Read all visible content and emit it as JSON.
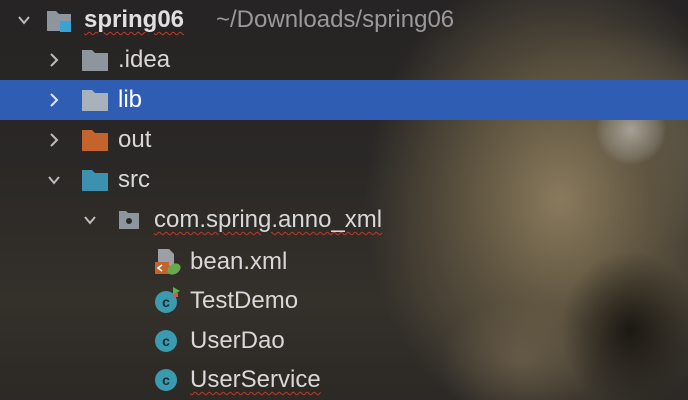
{
  "project_tree": {
    "root": {
      "name": "spring06",
      "path": "~/Downloads/spring06",
      "icon": "module-folder-icon"
    },
    "items": [
      {
        "label": ".idea",
        "icon": "folder-icon",
        "expanded": false,
        "selected": false
      },
      {
        "label": "lib",
        "icon": "folder-icon",
        "expanded": false,
        "selected": true
      },
      {
        "label": "out",
        "icon": "excluded-folder-icon",
        "expanded": false,
        "selected": false
      },
      {
        "label": "src",
        "icon": "source-folder-icon",
        "expanded": true,
        "selected": false
      },
      {
        "label": "com.spring.anno_xml",
        "icon": "package-icon",
        "expanded": true,
        "selected": false
      },
      {
        "label": "bean.xml",
        "icon": "spring-xml-file-icon",
        "selected": false
      },
      {
        "label": "TestDemo",
        "icon": "runnable-class-icon",
        "selected": false
      },
      {
        "label": "UserDao",
        "icon": "class-icon",
        "selected": false
      },
      {
        "label": "UserService",
        "icon": "class-icon",
        "selected": false
      }
    ]
  },
  "colors": {
    "selection": "#2f5db3",
    "folder_gray": "#8f959c",
    "excluded_orange": "#c4632b",
    "source_blue": "#3c91b0",
    "class_teal": "#3a9bb0",
    "error_underline": "#c0392b"
  }
}
